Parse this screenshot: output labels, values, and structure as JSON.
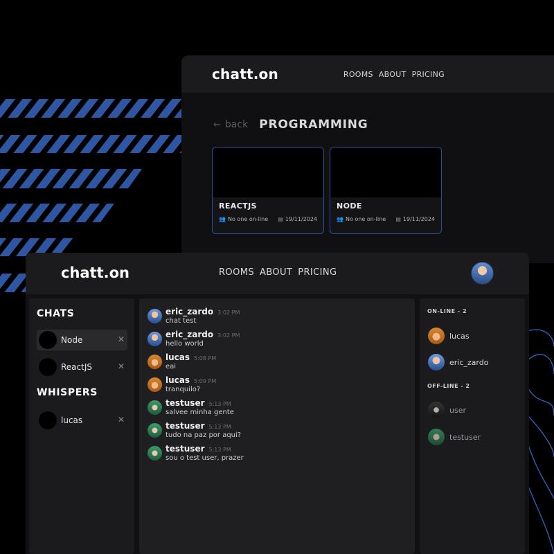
{
  "back_window": {
    "logo": "chatt.on",
    "nav": [
      "ROOMS",
      "ABOUT",
      "PRICING"
    ],
    "back_label": "back",
    "page_title": "PROGRAMMING",
    "rooms": [
      {
        "name": "REACTJS",
        "status": "No one on-line",
        "date": "19/11/2024"
      },
      {
        "name": "NODE",
        "status": "No one on-line",
        "date": "19/11/2024"
      }
    ]
  },
  "front_window": {
    "logo": "chatt.on",
    "nav": [
      "ROOMS",
      "ABOUT",
      "PRICING"
    ],
    "sidebar": {
      "chats_title": "CHATS",
      "chats": [
        {
          "label": "Node",
          "active": true
        },
        {
          "label": "ReactJS",
          "active": false
        }
      ],
      "whispers_title": "WHISPERS",
      "whispers": [
        {
          "label": "lucas"
        }
      ]
    },
    "messages": [
      {
        "user": "eric_zardo",
        "time": "3:02 PM",
        "text": "chat test"
      },
      {
        "user": "eric_zardo",
        "time": "3:02 PM",
        "text": "hello world"
      },
      {
        "user": "lucas",
        "time": "5:08 PM",
        "text": "eai"
      },
      {
        "user": "lucas",
        "time": "5:09 PM",
        "text": "tranquilo?"
      },
      {
        "user": "testuser",
        "time": "5:13 PM",
        "text": "salvee minha gente"
      },
      {
        "user": "testuser",
        "time": "5:13 PM",
        "text": "tudo na paz por aqui?"
      },
      {
        "user": "testuser",
        "time": "5:13 PM",
        "text": "sou o test user, prazer"
      }
    ],
    "members": {
      "online_title": "ON-LINE - 2",
      "online": [
        "lucas",
        "eric_zardo"
      ],
      "offline_title": "OFF-LINE - 2",
      "offline": [
        "user",
        "testuser"
      ]
    }
  },
  "colors": {
    "accent_blue": "#2e4f9a",
    "stripe_blue": "#2f56a3",
    "background": "#000000",
    "panel": "#1b1b1d"
  }
}
